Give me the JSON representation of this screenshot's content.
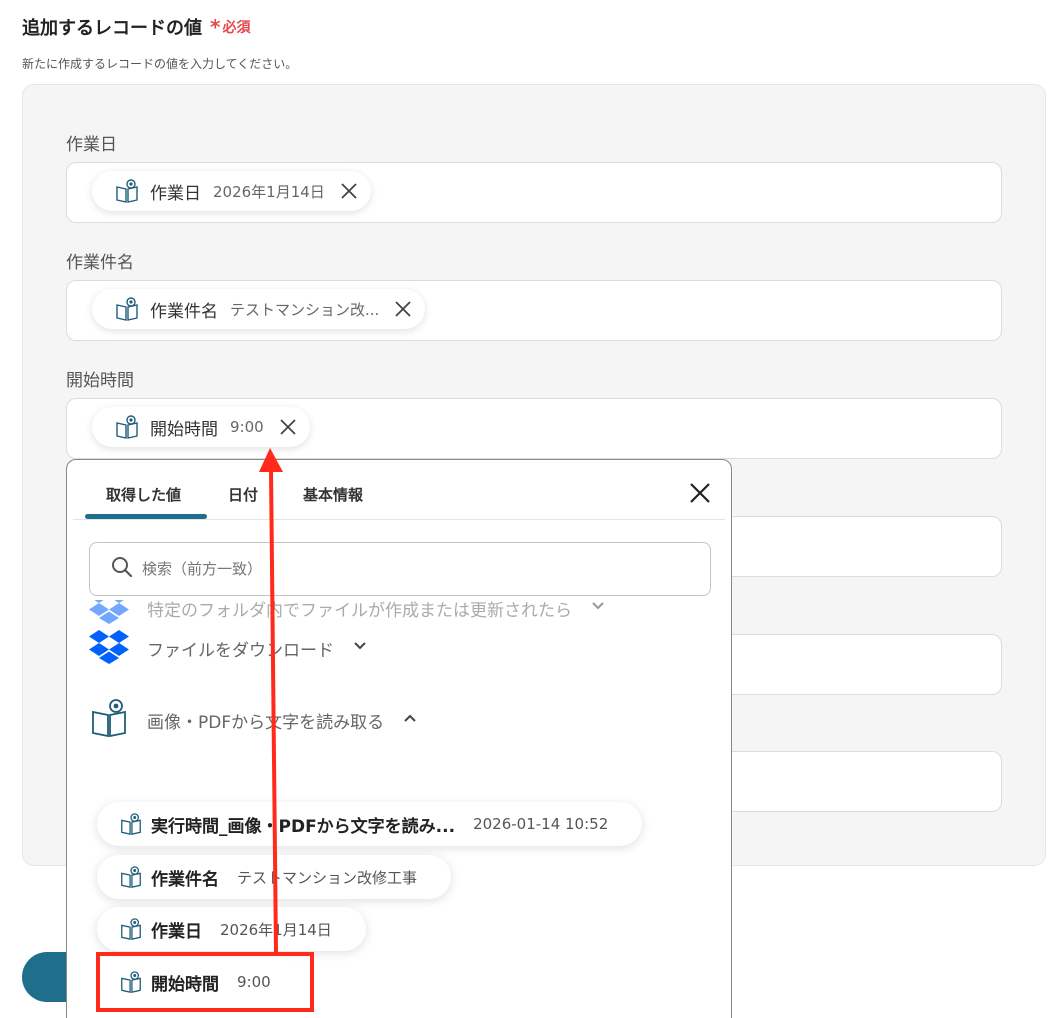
{
  "section": {
    "title": "追加するレコードの値",
    "required_mark": "*",
    "required_label": "必須",
    "description": "新たに作成するレコードの値を入力してください。"
  },
  "fields": [
    {
      "label": "作業日",
      "chip_name": "作業日",
      "chip_value": "2026年1月14日"
    },
    {
      "label": "作業件名",
      "chip_name": "作業件名",
      "chip_value": "テストマンション改..."
    },
    {
      "label": "開始時間",
      "chip_name": "開始時間",
      "chip_value": "9:00"
    }
  ],
  "dropdown": {
    "tabs": [
      "取得した値",
      "日付",
      "基本情報"
    ],
    "active_tab": "取得した値",
    "search_placeholder": "検索（前方一致）",
    "groups": [
      {
        "name": "特定のフォルダ内でファイルが作成または更新されたら",
        "icon": "dropbox-icon",
        "expanded": false
      },
      {
        "name": "ファイルをダウンロード",
        "icon": "dropbox-icon",
        "expanded": false
      },
      {
        "name": "画像・PDFから文字を読み取る",
        "icon": "ocr-book-icon",
        "expanded": true
      }
    ],
    "items": [
      {
        "name": "実行時間_画像・PDFから文字を読み...",
        "value": "2026-01-14 10:52"
      },
      {
        "name": "作業件名",
        "value": "テストマンション改修工事"
      },
      {
        "name": "作業日",
        "value": "2026年1月14日"
      },
      {
        "name": "開始時間",
        "value": "9:00"
      }
    ]
  },
  "colors": {
    "accent": "#1f6e8c",
    "required": "#e5484d",
    "highlight": "#ff2a1a",
    "dropbox": "#0061fe"
  }
}
